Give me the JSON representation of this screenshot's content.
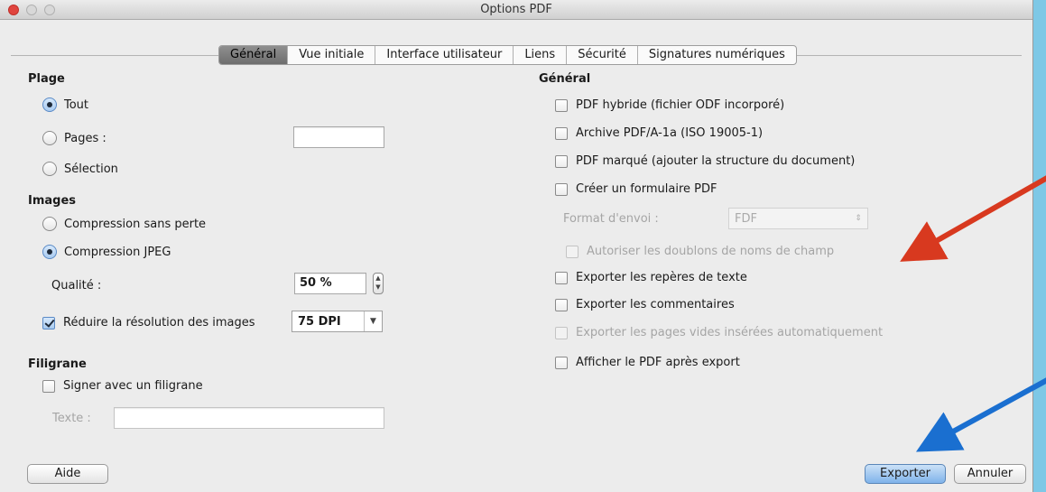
{
  "window": {
    "title": "Options PDF"
  },
  "tabs": [
    {
      "label": "Général",
      "active": true
    },
    {
      "label": "Vue initiale"
    },
    {
      "label": "Interface utilisateur"
    },
    {
      "label": "Liens"
    },
    {
      "label": "Sécurité"
    },
    {
      "label": "Signatures numériques"
    }
  ],
  "left": {
    "range": {
      "heading": "Plage",
      "all_label": "Tout",
      "pages_label": "Pages :",
      "pages_value": "",
      "selection_label": "Sélection"
    },
    "images": {
      "heading": "Images",
      "lossless_label": "Compression sans perte",
      "jpeg_label": "Compression JPEG",
      "quality_label": "Qualité :",
      "quality_value": "50 %",
      "reduce_label": "Réduire la résolution des images",
      "reduce_checked": true,
      "dpi_value": "75 DPI"
    },
    "watermark": {
      "heading": "Filigrane",
      "sign_label": "Signer avec un filigrane",
      "text_label": "Texte :",
      "text_value": ""
    }
  },
  "right": {
    "heading": "Général",
    "hybrid_label": "PDF hybride (fichier ODF incorporé)",
    "archive_label": "Archive PDF/A-1a (ISO 19005-1)",
    "tagged_label": "PDF marqué (ajouter la structure du document)",
    "form_label": "Créer un formulaire PDF",
    "submit_format_label": "Format d'envoi :",
    "submit_format_value": "FDF",
    "allow_duplicates_label": "Autoriser les doublons de noms de champ",
    "bookmarks_label": "Exporter les repères de texte",
    "comments_label": "Exporter les commentaires",
    "blank_pages_label": "Exporter les pages vides insérées automatiquement",
    "show_after_label": "Afficher le PDF après export"
  },
  "footer": {
    "help_label": "Aide",
    "export_label": "Exporter",
    "cancel_label": "Annuler"
  },
  "annotations": {
    "red_arrow_color": "#d8391f",
    "blue_arrow_color": "#1a6fd0"
  }
}
